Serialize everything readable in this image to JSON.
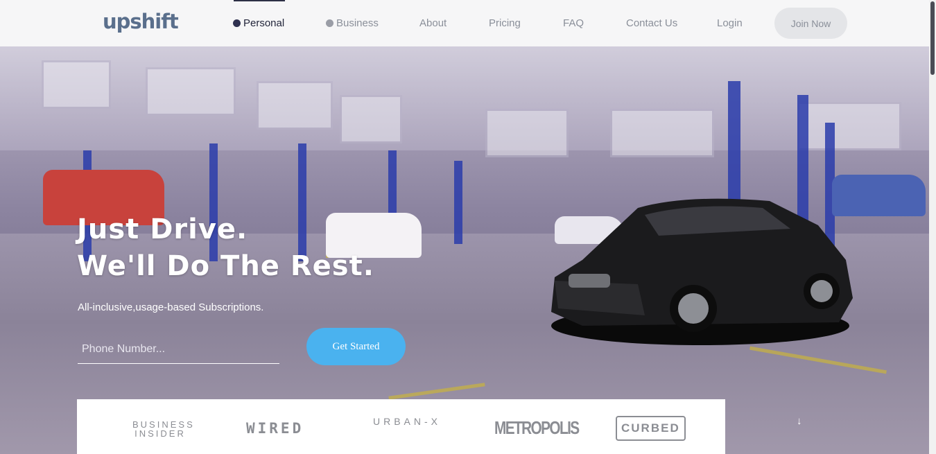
{
  "brand": {
    "logo": "upshift"
  },
  "nav": {
    "items": [
      {
        "label": "Personal",
        "active": true,
        "dot": "dark"
      },
      {
        "label": "Business",
        "active": false,
        "dot": "grey"
      },
      {
        "label": "About"
      },
      {
        "label": "Pricing"
      },
      {
        "label": "FAQ"
      },
      {
        "label": "Contact Us"
      },
      {
        "label": "Login"
      }
    ],
    "cta": "Join Now"
  },
  "hero": {
    "title_line1": "Just Drive.",
    "title_line2": "We'll Do The Rest.",
    "subtitle": "All-inclusive,usage-based Subscriptions.",
    "phone_placeholder": "Phone Number...",
    "cta": "Get Started"
  },
  "press": {
    "logos": [
      "BUSINESS INSIDER",
      "WIRED",
      "URBAN-X",
      "METROPOLIS",
      "CURBED"
    ]
  },
  "colors": {
    "accent": "#4ab2ef",
    "nav_bg": "#f6f6f7",
    "text_dark": "#22253a"
  },
  "icons": {
    "scroll_down": "arrow-down-icon"
  }
}
